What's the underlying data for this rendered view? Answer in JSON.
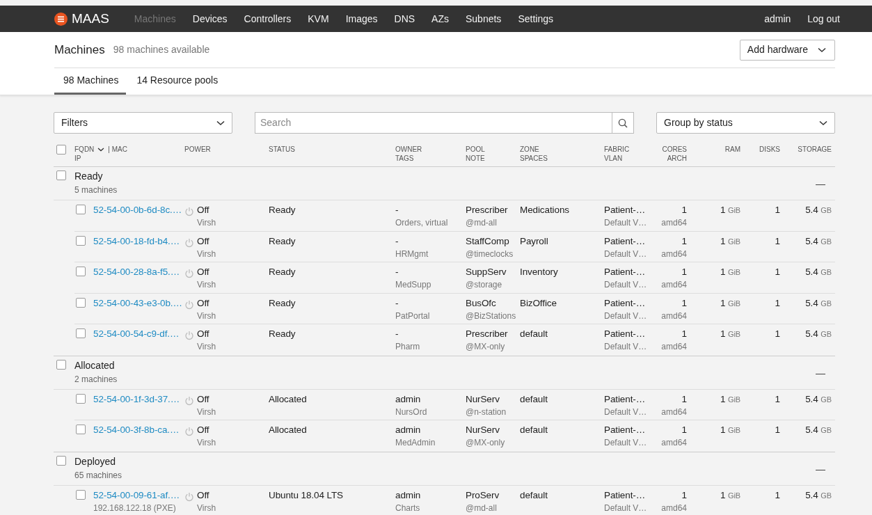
{
  "navbar": {
    "logo": "MAAS",
    "items": [
      {
        "label": "Machines",
        "selected": true
      },
      {
        "label": "Devices",
        "selected": false
      },
      {
        "label": "Controllers",
        "selected": false
      },
      {
        "label": "KVM",
        "selected": false
      },
      {
        "label": "Images",
        "selected": false
      },
      {
        "label": "DNS",
        "selected": false
      },
      {
        "label": "AZs",
        "selected": false
      },
      {
        "label": "Subnets",
        "selected": false
      },
      {
        "label": "Settings",
        "selected": false
      }
    ],
    "user": "admin",
    "logout": "Log out"
  },
  "header": {
    "title": "Machines",
    "subtitle": "98 machines available",
    "action": "Add hardware"
  },
  "tabs": [
    {
      "label": "98 Machines",
      "selected": true
    },
    {
      "label": "14 Resource pools",
      "selected": false
    }
  ],
  "filters": {
    "label": "Filters"
  },
  "search": {
    "placeholder": "Search"
  },
  "group_by": {
    "value": "Group by status"
  },
  "table": {
    "select_all_checked": false,
    "columns": [
      {
        "kind": "text",
        "line1": "FQDN",
        "sorted": true,
        "line1_after": "| MAC",
        "line2": "IP"
      },
      {
        "kind": "text",
        "line1": "POWER"
      },
      {
        "kind": "text",
        "line1": "STATUS"
      },
      {
        "kind": "text",
        "line1": "OWNER",
        "line2": "TAGS"
      },
      {
        "kind": "text",
        "line1": "POOL",
        "line2": "NOTE"
      },
      {
        "kind": "text",
        "line1": "ZONE",
        "line2": "SPACES"
      },
      {
        "kind": "text",
        "line1": "FABRIC",
        "line2": "VLAN"
      },
      {
        "kind": "number",
        "line1": "CORES",
        "line2": "ARCH"
      },
      {
        "kind": "number",
        "line1": "RAM"
      },
      {
        "kind": "number",
        "line1": "DISKS"
      },
      {
        "kind": "number",
        "line1": "STORAGE"
      }
    ],
    "groups": [
      {
        "name": "Ready",
        "count": "5 machines",
        "checked": false,
        "toggle": "—",
        "machines": [
          {
            "fqdn": "52-54-00-0b-6d-8c.…",
            "checked": false,
            "power": "Off",
            "power_type": "Virsh",
            "status": "Ready",
            "owner": "-",
            "tags": "Orders, virtual",
            "pool": "Prescriber",
            "note": "@md-all",
            "zone": "Medications",
            "fabric": "Patient-…",
            "vlan": "Default V…",
            "cores": "1",
            "arch": "amd64",
            "ram": "1",
            "ram_unit": "GiB",
            "disks": "1",
            "storage": "5.4",
            "storage_unit": "GB"
          },
          {
            "fqdn": "52-54-00-18-fd-b4.…",
            "checked": false,
            "power": "Off",
            "power_type": "Virsh",
            "status": "Ready",
            "owner": "-",
            "tags": "HRMgmt",
            "pool": "StaffComp",
            "note": "@timeclocks",
            "zone": "Payroll",
            "fabric": "Patient-…",
            "vlan": "Default V…",
            "cores": "1",
            "arch": "amd64",
            "ram": "1",
            "ram_unit": "GiB",
            "disks": "1",
            "storage": "5.4",
            "storage_unit": "GB"
          },
          {
            "fqdn": "52-54-00-28-8a-f5.…",
            "checked": false,
            "power": "Off",
            "power_type": "Virsh",
            "status": "Ready",
            "owner": "-",
            "tags": "MedSupp",
            "pool": "SuppServ",
            "note": "@storage",
            "zone": "Inventory",
            "fabric": "Patient-…",
            "vlan": "Default V…",
            "cores": "1",
            "arch": "amd64",
            "ram": "1",
            "ram_unit": "GiB",
            "disks": "1",
            "storage": "5.4",
            "storage_unit": "GB"
          },
          {
            "fqdn": "52-54-00-43-e3-0b.…",
            "checked": false,
            "power": "Off",
            "power_type": "Virsh",
            "status": "Ready",
            "owner": "-",
            "tags": "PatPortal",
            "pool": "BusOfc",
            "note": "@BizStations",
            "zone": "BizOffice",
            "fabric": "Patient-…",
            "vlan": "Default V…",
            "cores": "1",
            "arch": "amd64",
            "ram": "1",
            "ram_unit": "GiB",
            "disks": "1",
            "storage": "5.4",
            "storage_unit": "GB"
          },
          {
            "fqdn": "52-54-00-54-c9-df.…",
            "checked": false,
            "power": "Off",
            "power_type": "Virsh",
            "status": "Ready",
            "owner": "-",
            "tags": "Pharm",
            "pool": "Prescriber",
            "note": "@MX-only",
            "zone": "default",
            "fabric": "Patient-…",
            "vlan": "Default V…",
            "cores": "1",
            "arch": "amd64",
            "ram": "1",
            "ram_unit": "GiB",
            "disks": "1",
            "storage": "5.4",
            "storage_unit": "GB"
          }
        ]
      },
      {
        "name": "Allocated",
        "count": "2 machines",
        "checked": false,
        "toggle": "—",
        "machines": [
          {
            "fqdn": "52-54-00-1f-3d-37.…",
            "checked": false,
            "power": "Off",
            "power_type": "Virsh",
            "status": "Allocated",
            "owner": "admin",
            "tags": "NursOrd",
            "pool": "NurServ",
            "note": "@n-station",
            "zone": "default",
            "fabric": "Patient-…",
            "vlan": "Default V…",
            "cores": "1",
            "arch": "amd64",
            "ram": "1",
            "ram_unit": "GiB",
            "disks": "1",
            "storage": "5.4",
            "storage_unit": "GB"
          },
          {
            "fqdn": "52-54-00-3f-8b-ca.…",
            "checked": false,
            "power": "Off",
            "power_type": "Virsh",
            "status": "Allocated",
            "owner": "admin",
            "tags": "MedAdmin",
            "pool": "NurServ",
            "note": "@MX-only",
            "zone": "default",
            "fabric": "Patient-…",
            "vlan": "Default V…",
            "cores": "1",
            "arch": "amd64",
            "ram": "1",
            "ram_unit": "GiB",
            "disks": "1",
            "storage": "5.4",
            "storage_unit": "GB"
          }
        ]
      },
      {
        "name": "Deployed",
        "count": "65 machines",
        "checked": false,
        "toggle": "—",
        "machines": [
          {
            "fqdn": "52-54-00-09-61-af.…",
            "ip": "192.168.122.18 (PXE)",
            "checked": false,
            "power": "Off",
            "power_type": "Virsh",
            "status": "Ubuntu 18.04 LTS",
            "owner": "admin",
            "tags": "Charts",
            "pool": "ProServ",
            "note": "@md-all",
            "zone": "default",
            "fabric": "Patient-…",
            "vlan": "Default V…",
            "cores": "1",
            "arch": "amd64",
            "ram": "1",
            "ram_unit": "GiB",
            "disks": "1",
            "storage": "5.4",
            "storage_unit": "GB"
          }
        ]
      }
    ]
  }
}
